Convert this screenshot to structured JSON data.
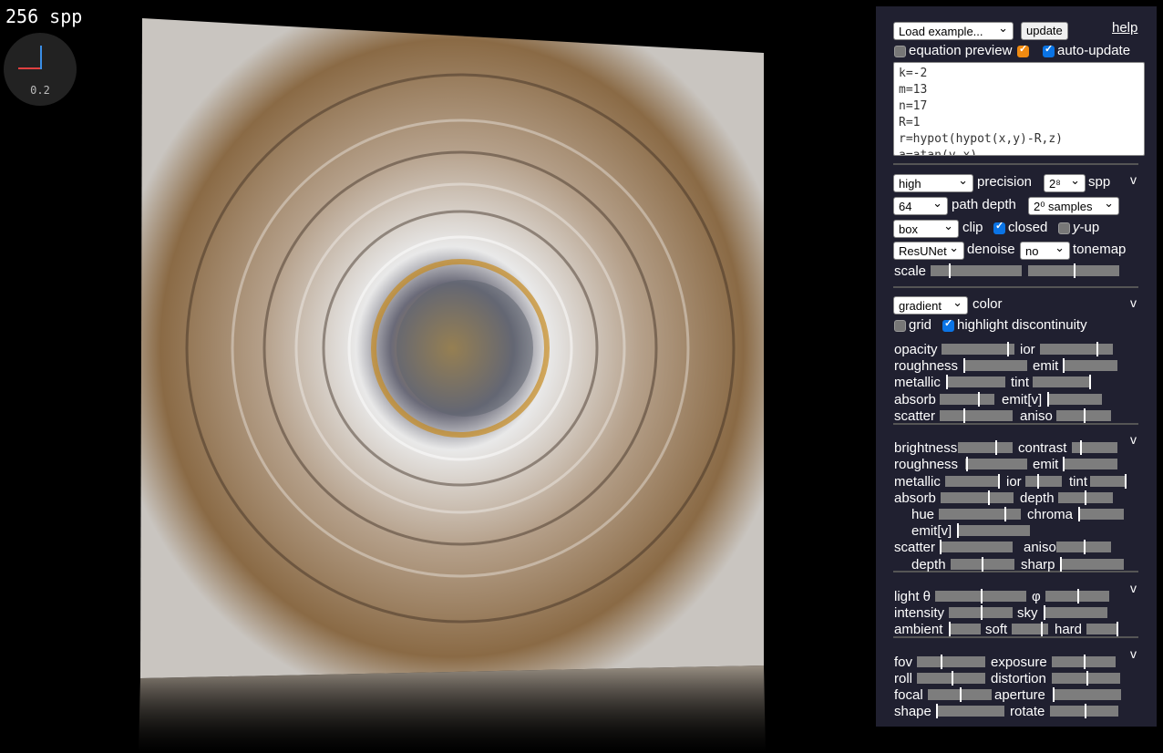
{
  "overlay": {
    "spp_counter": "256 spp",
    "gizmo_value": "0.2"
  },
  "top": {
    "example_select": "Load example...",
    "update_label": "update",
    "help_label": "help",
    "equation_preview_label": "equation preview",
    "auto_update_label": "auto-update",
    "equation_preview_checked": false,
    "auto_update_checked": true
  },
  "equation_lines": [
    "k=-2",
    "m=13",
    "n=17",
    "R=1",
    "r=hypot(hypot(x,y)-R,z)",
    "a=atan(y,x)"
  ],
  "render": {
    "precision_value": "high",
    "precision_label": "precision",
    "spp_value": "2⁸",
    "spp_label": "spp",
    "path_depth_value": "64",
    "path_depth_label": "path depth",
    "samples_value": "2⁰ samples",
    "clip_value": "box",
    "clip_label": "clip",
    "closed_label": "closed",
    "closed_checked": true,
    "yup_label_y": "y",
    "yup_label_rest": "-up",
    "yup_checked": false,
    "denoise_value": "ResUNet",
    "denoise_label": "denoise",
    "tonemap_value": "no",
    "tonemap_label": "tonemap",
    "scale_label": "scale",
    "scale_sliders": [
      0.2,
      0.5
    ]
  },
  "material": {
    "color_value": "gradient",
    "color_label": "color",
    "grid_label": "grid",
    "grid_checked": false,
    "highlight_label": "highlight discontinuity",
    "highlight_checked": true,
    "rows": [
      [
        "opacity",
        0.9,
        "ior",
        0.78
      ],
      [
        "roughness",
        0.0,
        "emit",
        0.0
      ],
      [
        "metallic",
        0.0,
        "tint",
        0.98
      ],
      [
        "absorb",
        0.7,
        "emit[v]",
        0.0
      ],
      [
        "scatter",
        0.33,
        "aniso",
        0.5
      ]
    ]
  },
  "material2": {
    "rows": [
      [
        "brightness",
        0.68,
        "contrast",
        0.18
      ],
      [
        "roughness",
        0.02,
        "emit",
        0.0
      ],
      [
        "metallic",
        1.0,
        "ior",
        0.33,
        "tint",
        0.97
      ],
      [
        "absorb",
        0.65,
        "depth",
        0.48
      ],
      [
        "hue",
        0.8,
        "chroma",
        0.0
      ],
      [
        "emit[v]",
        0.0
      ],
      [
        "scatter",
        0.0,
        "aniso",
        0.5
      ],
      [
        "depth",
        0.48,
        "sharp",
        0.0
      ]
    ]
  },
  "light": {
    "theta_label": "light θ",
    "phi_label": "φ",
    "theta": 0.5,
    "phi": 0.5,
    "intensity_label": "intensity",
    "intensity": 0.5,
    "sky_label": "sky",
    "sky": 0.0,
    "ambient_label": "ambient",
    "ambient": 0.0,
    "soft_label": "soft",
    "soft": 0.8,
    "hard_label": "hard",
    "hard": 0.97
  },
  "camera": {
    "fov_label": "fov",
    "fov": 0.35,
    "exposure_label": "exposure",
    "exposure": 0.5,
    "roll_label": "roll",
    "roll": 0.5,
    "distortion_label": "distortion",
    "distortion": 0.5,
    "focal_label": "focal",
    "focal": 0.5,
    "aperture_label": "aperture",
    "aperture": 0.0,
    "shape_label": "shape",
    "shape": 0.0,
    "rotate_label": "rotate",
    "rotate": 0.5
  },
  "section_toggle": "v",
  "colors": {
    "panel": "#202030",
    "slider": "#7d7d7d",
    "checkbox_on": "#0b74e5",
    "preview_checkbox": "#ef8a12"
  }
}
